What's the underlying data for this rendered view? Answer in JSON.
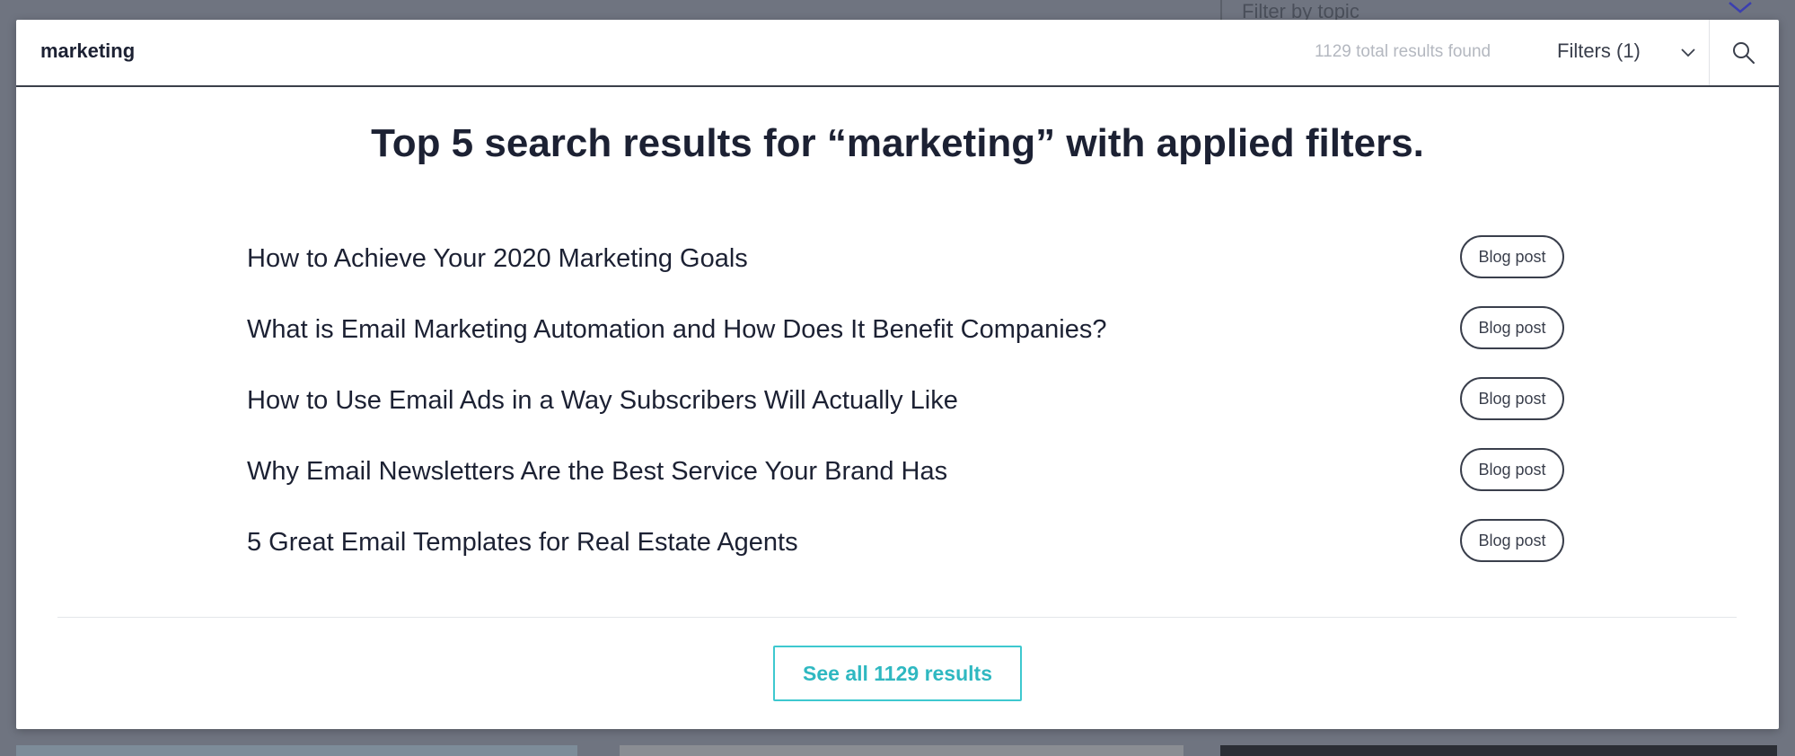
{
  "background": {
    "filter_placeholder": "Filter by topic"
  },
  "search": {
    "query": "marketing",
    "results_count_text": "1129 total results found",
    "filters_label": "Filters (1)"
  },
  "heading": "Top 5 search results for “marketing” with applied filters.",
  "results": [
    {
      "title": "How to Achieve Your 2020 Marketing Goals",
      "type": "Blog post"
    },
    {
      "title": "What is Email Marketing Automation and How Does It Benefit Companies?",
      "type": "Blog post"
    },
    {
      "title": "How to Use Email Ads in a Way Subscribers Will Actually Like",
      "type": "Blog post"
    },
    {
      "title": "Why Email Newsletters Are the Best Service Your Brand Has",
      "type": "Blog post"
    },
    {
      "title": "5 Great Email Templates for Real Estate Agents",
      "type": "Blog post"
    }
  ],
  "see_all_label": "See all 1129 results",
  "colors": {
    "accent": "#3ec8cf",
    "text": "#1c2133",
    "muted": "#b4b8c0",
    "backdrop": "#6f7480"
  },
  "icons": {
    "search": "search-icon",
    "filters_chevron": "chevron-down-icon",
    "background_chevron": "chevron-down-icon"
  }
}
